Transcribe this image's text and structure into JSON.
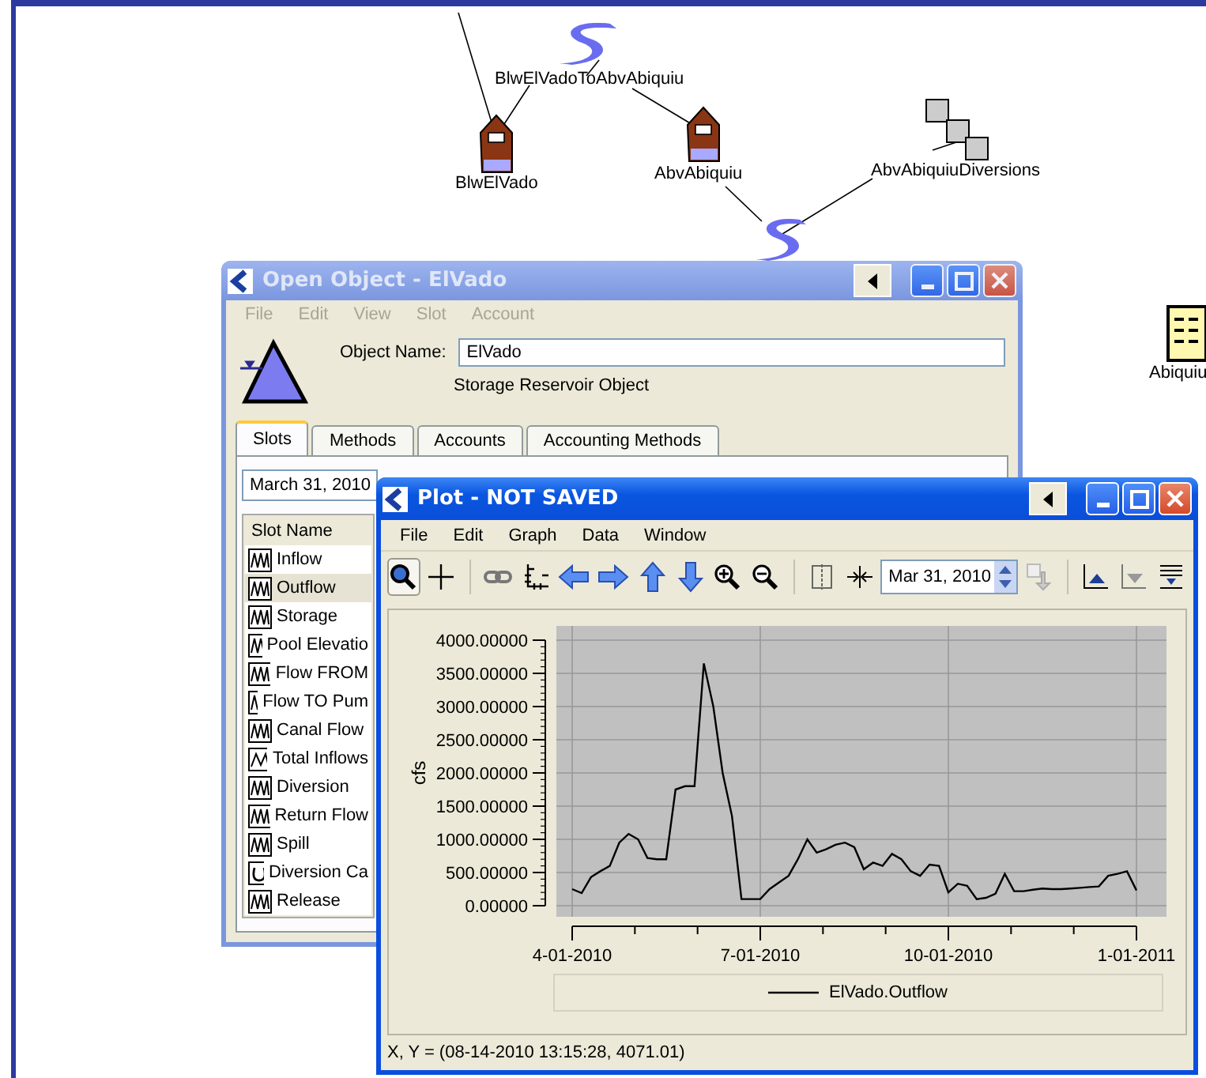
{
  "canvas": {
    "nodes": [
      {
        "kind": "reach",
        "label": "BlwElVadoToAbvAbiquiu"
      },
      {
        "kind": "reservoir",
        "label": "BlwElVado"
      },
      {
        "kind": "reservoir",
        "label": "AbvAbiquiu"
      },
      {
        "kind": "diversion",
        "label": "AbvAbiquiuDiversions"
      },
      {
        "kind": "reach"
      },
      {
        "kind": "datatable",
        "label": "Abiquiu"
      }
    ]
  },
  "open_object": {
    "title": "Open Object - ElVado",
    "menu": [
      "File",
      "Edit",
      "View",
      "Slot",
      "Account"
    ],
    "object_name_label": "Object Name:",
    "object_name": "ElVado",
    "object_type": "Storage Reservoir Object",
    "tabs": [
      {
        "label": "Slots",
        "selected": true
      },
      {
        "label": "Methods",
        "selected": false
      },
      {
        "label": "Accounts",
        "selected": false
      },
      {
        "label": "Accounting Methods",
        "selected": false
      }
    ],
    "date": "March 31, 2010",
    "slot_header": "Slot Name",
    "slots": [
      {
        "name": "Inflow",
        "kind": "series",
        "selected": false
      },
      {
        "name": "Outflow",
        "kind": "series",
        "selected": true
      },
      {
        "name": "Storage",
        "kind": "series",
        "selected": false
      },
      {
        "name": "Pool Elevatio",
        "kind": "series",
        "selected": false
      },
      {
        "name": "Flow FROM",
        "kind": "series",
        "selected": false
      },
      {
        "name": "Flow TO Pum",
        "kind": "series",
        "selected": false
      },
      {
        "name": "Canal Flow",
        "kind": "series",
        "selected": false
      },
      {
        "name": "Total Inflows",
        "kind": "agg",
        "selected": false
      },
      {
        "name": "Diversion",
        "kind": "series",
        "selected": false
      },
      {
        "name": "Return Flow",
        "kind": "series",
        "selected": false
      },
      {
        "name": "Spill",
        "kind": "series",
        "selected": false
      },
      {
        "name": "Diversion Ca",
        "kind": "periodic",
        "selected": false
      },
      {
        "name": "Release",
        "kind": "series",
        "selected": false
      }
    ]
  },
  "plot": {
    "title": "Plot - NOT SAVED",
    "menu": [
      "File",
      "Edit",
      "Graph",
      "Data",
      "Window"
    ],
    "mode_tools": [
      {
        "selected": true
      },
      {
        "selected": false
      }
    ],
    "date": "Mar 31, 2010",
    "chart_data": {
      "type": "line",
      "ylabel": "cfs",
      "grid": true,
      "categories": [
        "4-01-2010",
        null,
        null,
        null,
        null,
        null,
        null,
        null,
        null,
        null,
        null,
        null,
        null,
        null,
        null,
        null,
        null,
        null,
        null,
        null,
        "7-01-2010",
        null,
        null,
        null,
        null,
        null,
        null,
        null,
        null,
        null,
        null,
        null,
        null,
        null,
        null,
        null,
        null,
        null,
        null,
        null,
        "10-01-2010",
        null,
        null,
        null,
        null,
        null,
        null,
        null,
        null,
        null,
        null,
        null,
        null,
        null,
        null,
        null,
        null,
        null,
        null,
        null,
        "1-01-2011"
      ],
      "series": [
        {
          "name": "ElVado.Outflow",
          "color": "#000000",
          "values": [
            250,
            190,
            430,
            520,
            600,
            950,
            1080,
            1000,
            720,
            700,
            700,
            1750,
            1800,
            1800,
            3650,
            3000,
            2000,
            1350,
            100,
            100,
            100,
            250,
            350,
            450,
            700,
            1000,
            800,
            850,
            920,
            950,
            880,
            550,
            650,
            600,
            780,
            700,
            520,
            450,
            620,
            600,
            200,
            330,
            300,
            100,
            120,
            180,
            480,
            220,
            220,
            240,
            260,
            250,
            250,
            260,
            270,
            280,
            290,
            450,
            480,
            520,
            230
          ]
        }
      ],
      "ylim": [
        0,
        4000
      ],
      "yticks": [
        {
          "value": 0,
          "label": "0.00000"
        },
        {
          "value": 500,
          "label": "500.00000"
        },
        {
          "value": 1000,
          "label": "1000.00000"
        },
        {
          "value": 1500,
          "label": "1500.00000"
        },
        {
          "value": 2000,
          "label": "2000.00000"
        },
        {
          "value": 2500,
          "label": "2500.00000"
        },
        {
          "value": 3000,
          "label": "3000.00000"
        },
        {
          "value": 3500,
          "label": "3500.00000"
        },
        {
          "value": 4000,
          "label": "4000.00000"
        }
      ]
    },
    "status": "X, Y = (08-14-2010 13:15:28, 4071.01)"
  }
}
